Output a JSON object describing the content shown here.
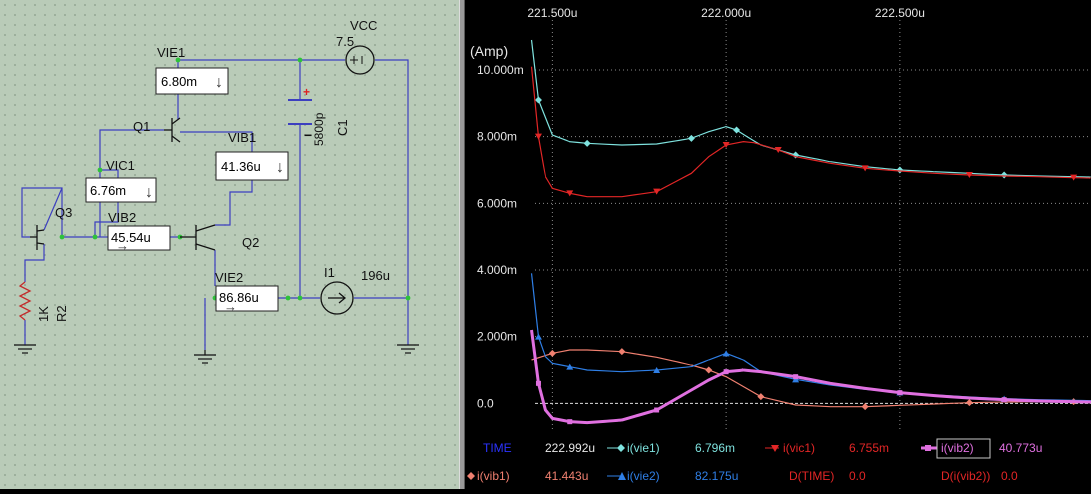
{
  "schematic": {
    "components": {
      "vcc": "VCC",
      "vcc_value": "7.5",
      "q1": "Q1",
      "q2": "Q2",
      "q3": "Q3",
      "r2_value": "1K",
      "r2": "R2",
      "c1_value": "5800p",
      "c1": "C1",
      "i1": "I1",
      "i1_value": "196u",
      "cap_plus": "+",
      "cap_minus": "−"
    },
    "meters": [
      {
        "name": "VIE1",
        "value": "6.80m",
        "arrow": "↓"
      },
      {
        "name": "VIB1",
        "value": "41.36u",
        "arrow": "↓"
      },
      {
        "name": "VIC1",
        "value": "6.76m",
        "arrow": "↓"
      },
      {
        "name": "VIB2",
        "value": "45.54u",
        "arrow": "→"
      },
      {
        "name": "VIE2",
        "value": "86.86u",
        "arrow": "→"
      }
    ]
  },
  "graph": {
    "y_unit": "(Amp)",
    "x_tick_labels": [
      "221.500u",
      "222.000u",
      "222.500u"
    ],
    "y_tick_labels": [
      "10.000m",
      "8.000m",
      "6.000m",
      "4.000m",
      "2.000m",
      "0.0"
    ],
    "zero_line": true,
    "grid": "dotted",
    "legend_row1": [
      {
        "label": "TIME",
        "value": "222.992u",
        "color": "#2b33ff"
      },
      {
        "label": "i(vie1)",
        "value": "6.796m",
        "color": "#7fe3df"
      },
      {
        "label": "i(vic1)",
        "value": "6.755m",
        "color": "#e32626"
      },
      {
        "label": "i(vib2)",
        "value": "40.773u",
        "color": "#e070e0"
      }
    ],
    "legend_row2": [
      {
        "label": "i(vib1)",
        "value": "41.443u",
        "color": "#f08070"
      },
      {
        "label": "i(vie2)",
        "value": "82.175u",
        "color": "#2f7fe6"
      },
      {
        "label": "D(TIME)",
        "value": "0.0",
        "color": "#e32626"
      },
      {
        "label": "D(i(vib2))",
        "value": "0.0",
        "color": "#e32626"
      }
    ]
  },
  "chart_data": {
    "type": "line",
    "xlabel": "",
    "ylabel": "(Amp)",
    "x_unit": "u",
    "xlim": [
      221.45,
      223.05
    ],
    "ylim": [
      -0.8,
      11.5
    ],
    "x_ticks": [
      221.5,
      222.0,
      222.5
    ],
    "y_ticks": [
      0,
      2,
      4,
      6,
      8,
      10
    ],
    "legend": "bottom",
    "series": [
      {
        "name": "i(vie1)",
        "color": "#7fe3df",
        "marker": "diamond",
        "x": [
          221.44,
          221.46,
          221.5,
          221.55,
          221.6,
          221.7,
          221.8,
          221.9,
          221.95,
          222.0,
          222.03,
          222.06,
          222.1,
          222.2,
          222.3,
          222.4,
          222.5,
          222.6,
          222.7,
          222.8,
          222.9,
          223.0,
          223.05
        ],
        "y": [
          10.9,
          9.1,
          8.05,
          7.85,
          7.8,
          7.75,
          7.78,
          7.95,
          8.15,
          8.3,
          8.2,
          8.0,
          7.75,
          7.45,
          7.25,
          7.1,
          7.0,
          6.95,
          6.9,
          6.85,
          6.82,
          6.8,
          6.79
        ]
      },
      {
        "name": "i(vic1)",
        "color": "#e32626",
        "marker": "triangle-down",
        "x": [
          221.44,
          221.46,
          221.48,
          221.5,
          221.55,
          221.6,
          221.7,
          221.8,
          221.9,
          221.95,
          222.0,
          222.05,
          222.08,
          222.15,
          222.2,
          222.3,
          222.4,
          222.5,
          222.6,
          222.7,
          222.8,
          222.9,
          223.0,
          223.05
        ],
        "y": [
          10.1,
          8.0,
          6.8,
          6.45,
          6.3,
          6.2,
          6.2,
          6.35,
          6.9,
          7.4,
          7.75,
          7.85,
          7.82,
          7.6,
          7.4,
          7.2,
          7.05,
          6.97,
          6.9,
          6.85,
          6.82,
          6.8,
          6.77,
          6.76
        ]
      },
      {
        "name": "i(vib1)",
        "color": "#f08070",
        "marker": "diamond",
        "x": [
          221.44,
          221.5,
          221.55,
          221.6,
          221.7,
          221.8,
          221.9,
          221.95,
          222.0,
          222.05,
          222.1,
          222.2,
          222.3,
          222.4,
          222.5,
          222.6,
          222.7,
          222.8,
          222.9,
          223.0,
          223.05
        ],
        "y": [
          1.3,
          1.5,
          1.6,
          1.6,
          1.55,
          1.38,
          1.15,
          1.0,
          0.8,
          0.5,
          0.2,
          -0.05,
          -0.1,
          -0.1,
          -0.06,
          -0.02,
          0.02,
          0.04,
          0.05,
          0.05,
          0.05
        ]
      },
      {
        "name": "i(vie2)",
        "color": "#2f7fe6",
        "marker": "triangle-up",
        "x": [
          221.44,
          221.46,
          221.48,
          221.5,
          221.55,
          221.6,
          221.7,
          221.8,
          221.9,
          221.95,
          222.0,
          222.05,
          222.1,
          222.2,
          222.3,
          222.4,
          222.5,
          222.6,
          222.7,
          222.8,
          222.9,
          223.0,
          223.05
        ],
        "y": [
          3.9,
          2.0,
          1.4,
          1.2,
          1.1,
          1.0,
          0.95,
          1.0,
          1.1,
          1.3,
          1.5,
          1.3,
          0.95,
          0.72,
          0.55,
          0.42,
          0.33,
          0.25,
          0.19,
          0.14,
          0.11,
          0.09,
          0.08
        ]
      },
      {
        "name": "i(vib2)",
        "color": "#e070e0",
        "marker": "square",
        "line_width": 3,
        "x": [
          221.44,
          221.46,
          221.48,
          221.5,
          221.55,
          221.6,
          221.7,
          221.8,
          221.9,
          221.95,
          222.0,
          222.05,
          222.1,
          222.2,
          222.3,
          222.4,
          222.5,
          222.6,
          222.7,
          222.8,
          222.9,
          223.0,
          223.05
        ],
        "y": [
          2.2,
          0.6,
          -0.2,
          -0.45,
          -0.55,
          -0.58,
          -0.5,
          -0.2,
          0.4,
          0.7,
          0.95,
          1.0,
          0.95,
          0.8,
          0.6,
          0.45,
          0.32,
          0.23,
          0.16,
          0.11,
          0.07,
          0.05,
          0.04
        ]
      }
    ]
  }
}
